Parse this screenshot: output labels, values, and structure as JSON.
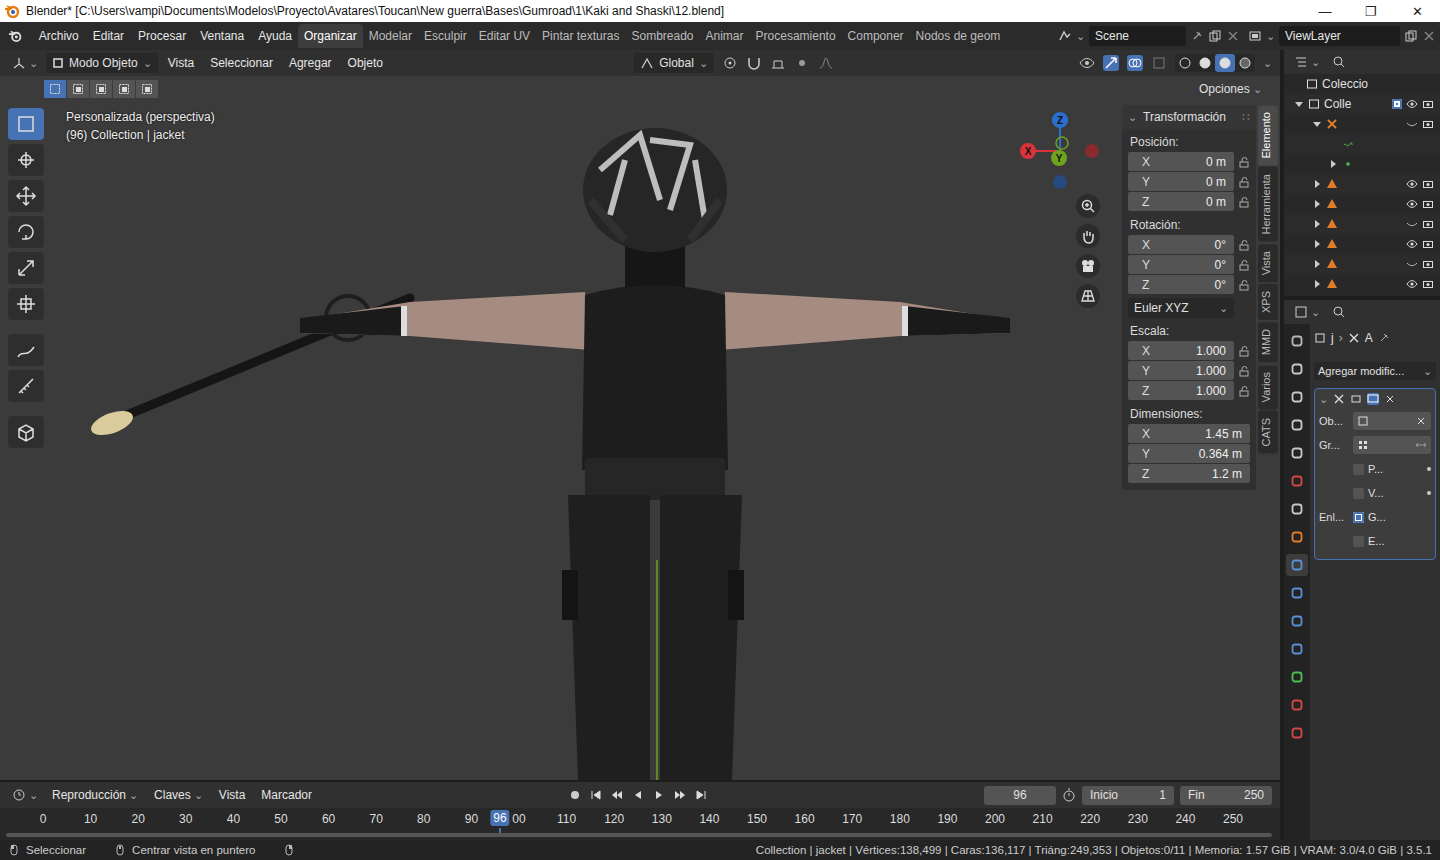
{
  "window": {
    "title": "Blender* [C:\\Users\\vampi\\Documents\\Modelos\\Proyecto\\Avatares\\Toucan\\New guerra\\Bases\\Gumroad\\1\\Kaki and Shaski\\12.blend]",
    "controls": [
      "—",
      "❐",
      "✕"
    ]
  },
  "menu": [
    "Archivo",
    "Editar",
    "Procesar",
    "Ventana",
    "Ayuda"
  ],
  "workspaces": [
    {
      "label": "Organizar",
      "selected": true
    },
    {
      "label": "Modelar",
      "selected": false
    },
    {
      "label": "Esculpir",
      "selected": false
    },
    {
      "label": "Editar UV",
      "selected": false
    },
    {
      "label": "Pintar texturas",
      "selected": false
    },
    {
      "label": "Sombreado",
      "selected": false
    },
    {
      "label": "Animar",
      "selected": false
    },
    {
      "label": "Procesamiento",
      "selected": false
    },
    {
      "label": "Componer",
      "selected": false
    },
    {
      "label": "Nodos de geom",
      "selected": false
    }
  ],
  "scene": "Scene",
  "view_layer": "ViewLayer",
  "viewport": {
    "mode": "Modo Objeto",
    "menus": [
      "Vista",
      "Seleccionar",
      "Agregar",
      "Objeto"
    ],
    "orientation": "Global",
    "options": "Opciones",
    "view_name": "Personalizada (perspectiva)",
    "context": "(96) Collection | jacket",
    "select_modes": [
      {
        "selected": true
      },
      {
        "selected": false
      },
      {
        "selected": false
      },
      {
        "selected": false
      },
      {
        "selected": false
      }
    ],
    "shading": [
      {
        "selected": false
      },
      {
        "selected": false
      },
      {
        "selected": true
      },
      {
        "selected": false
      }
    ],
    "tools": [
      {
        "selected": true
      },
      {
        "selected": false
      },
      {
        "selected": false
      },
      {
        "selected": false
      },
      {
        "selected": false
      },
      {
        "selected": false
      },
      {
        "selected": false
      },
      {
        "selected": false
      },
      {
        "selected": false
      }
    ],
    "gizmo": {
      "x": "X",
      "y": "Y",
      "z": "Z"
    }
  },
  "sidebar": {
    "panel": "Transformación",
    "groups": [
      {
        "label": "Posición:",
        "locks": true,
        "fields": [
          {
            "axis": "X",
            "value": "0 m"
          },
          {
            "axis": "Y",
            "value": "0 m"
          },
          {
            "axis": "Z",
            "value": "0 m"
          }
        ]
      },
      {
        "label": "Rotación:",
        "locks": true,
        "dropdown": "Euler XYZ",
        "fields": [
          {
            "axis": "X",
            "value": "0°"
          },
          {
            "axis": "Y",
            "value": "0°"
          },
          {
            "axis": "Z",
            "value": "0°"
          }
        ]
      },
      {
        "label": "Escala:",
        "locks": true,
        "fields": [
          {
            "axis": "X",
            "value": "1.000"
          },
          {
            "axis": "Y",
            "value": "1.000"
          },
          {
            "axis": "Z",
            "value": "1.000"
          }
        ]
      },
      {
        "label": "Dimensiones:",
        "locks": false,
        "fields": [
          {
            "axis": "X",
            "value": "1.45 m"
          },
          {
            "axis": "Y",
            "value": "0.364 m"
          },
          {
            "axis": "Z",
            "value": "1.2 m"
          }
        ]
      }
    ],
    "tabs": [
      {
        "label": "Elemento",
        "selected": true
      },
      {
        "label": "Herramienta",
        "selected": false
      },
      {
        "label": "Vista",
        "selected": false
      },
      {
        "label": "XPS",
        "selected": false
      },
      {
        "label": "MMD",
        "selected": false
      },
      {
        "label": "Varios",
        "selected": false
      },
      {
        "label": "CATS",
        "selected": false
      }
    ]
  },
  "outliner": {
    "rows": [
      {
        "label": "Coleccio",
        "kind": "scene"
      },
      {
        "label": "Colle",
        "kind": "collection",
        "expanded": true,
        "checked": true,
        "visible": true
      },
      {
        "kind": "armature",
        "expanded": true,
        "visible": false
      },
      {
        "kind": "vgroup"
      },
      {
        "kind": "dot",
        "expanded": false
      },
      {
        "kind": "mesh",
        "expanded": false,
        "visible": true
      },
      {
        "kind": "mesh",
        "expanded": false,
        "visible": true
      },
      {
        "kind": "mesh",
        "expanded": false,
        "visible": false
      },
      {
        "kind": "mesh",
        "expanded": false,
        "visible": true
      },
      {
        "kind": "mesh",
        "expanded": false,
        "visible": false
      },
      {
        "kind": "mesh",
        "expanded": false,
        "visible": true
      }
    ]
  },
  "properties": {
    "header": [
      "j",
      "A"
    ],
    "add_modifier": "Agregar modific...",
    "tabs": [
      {
        "color": "#b8b8b8",
        "selected": false
      },
      {
        "color": "#c8c8c8",
        "selected": false
      },
      {
        "color": "#c8c8c8",
        "selected": false
      },
      {
        "color": "#c8c8c8",
        "selected": false
      },
      {
        "color": "#c8c8c8",
        "selected": false
      },
      {
        "color": "#d04848",
        "selected": false
      },
      {
        "color": "#c8c8c8",
        "selected": false
      },
      {
        "color": "#e07d2a",
        "selected": false
      },
      {
        "color": "#5b8fd6",
        "selected": true
      },
      {
        "color": "#5b8fd6",
        "selected": false
      },
      {
        "color": "#5b8fd6",
        "selected": false
      },
      {
        "color": "#5b8fd6",
        "selected": false
      },
      {
        "color": "#4fbf4f",
        "selected": false
      },
      {
        "color": "#d04848",
        "selected": false
      },
      {
        "color": "#d04848",
        "selected": false
      }
    ],
    "modifier": {
      "fields": [
        {
          "label": "Ob..."
        },
        {
          "label": "Gr..."
        }
      ],
      "checks": [
        {
          "label": "P...",
          "checked": false
        },
        {
          "label": "V...",
          "checked": false
        }
      ],
      "bind_label": "Enl...",
      "binds": [
        {
          "label": "G...",
          "checked": true
        },
        {
          "label": "E...",
          "checked": false
        }
      ]
    }
  },
  "timeline": {
    "menus": [
      "Reproducción",
      "Claves",
      "Vista",
      "Marcador"
    ],
    "current": "96",
    "start_label": "Inicio",
    "start": "1",
    "end_label": "Fin",
    "end": "250",
    "ticks": [
      "0",
      "10",
      "20",
      "30",
      "40",
      "50",
      "60",
      "70",
      "80",
      "90",
      "00",
      "110",
      "120",
      "130",
      "140",
      "150",
      "160",
      "170",
      "180",
      "190",
      "200",
      "210",
      "220",
      "230",
      "240",
      "250"
    ]
  },
  "status_bar": {
    "left": [
      "Seleccionar",
      "Centrar vista en puntero"
    ],
    "right": "Collection | jacket | Vértices:138,499 | Caras:136,117 | Triáng:249,353 | Objetos:0/11 | Memoria: 1.57 GiB | VRAM: 3.0/4.0 GiB | 3.5.1"
  }
}
